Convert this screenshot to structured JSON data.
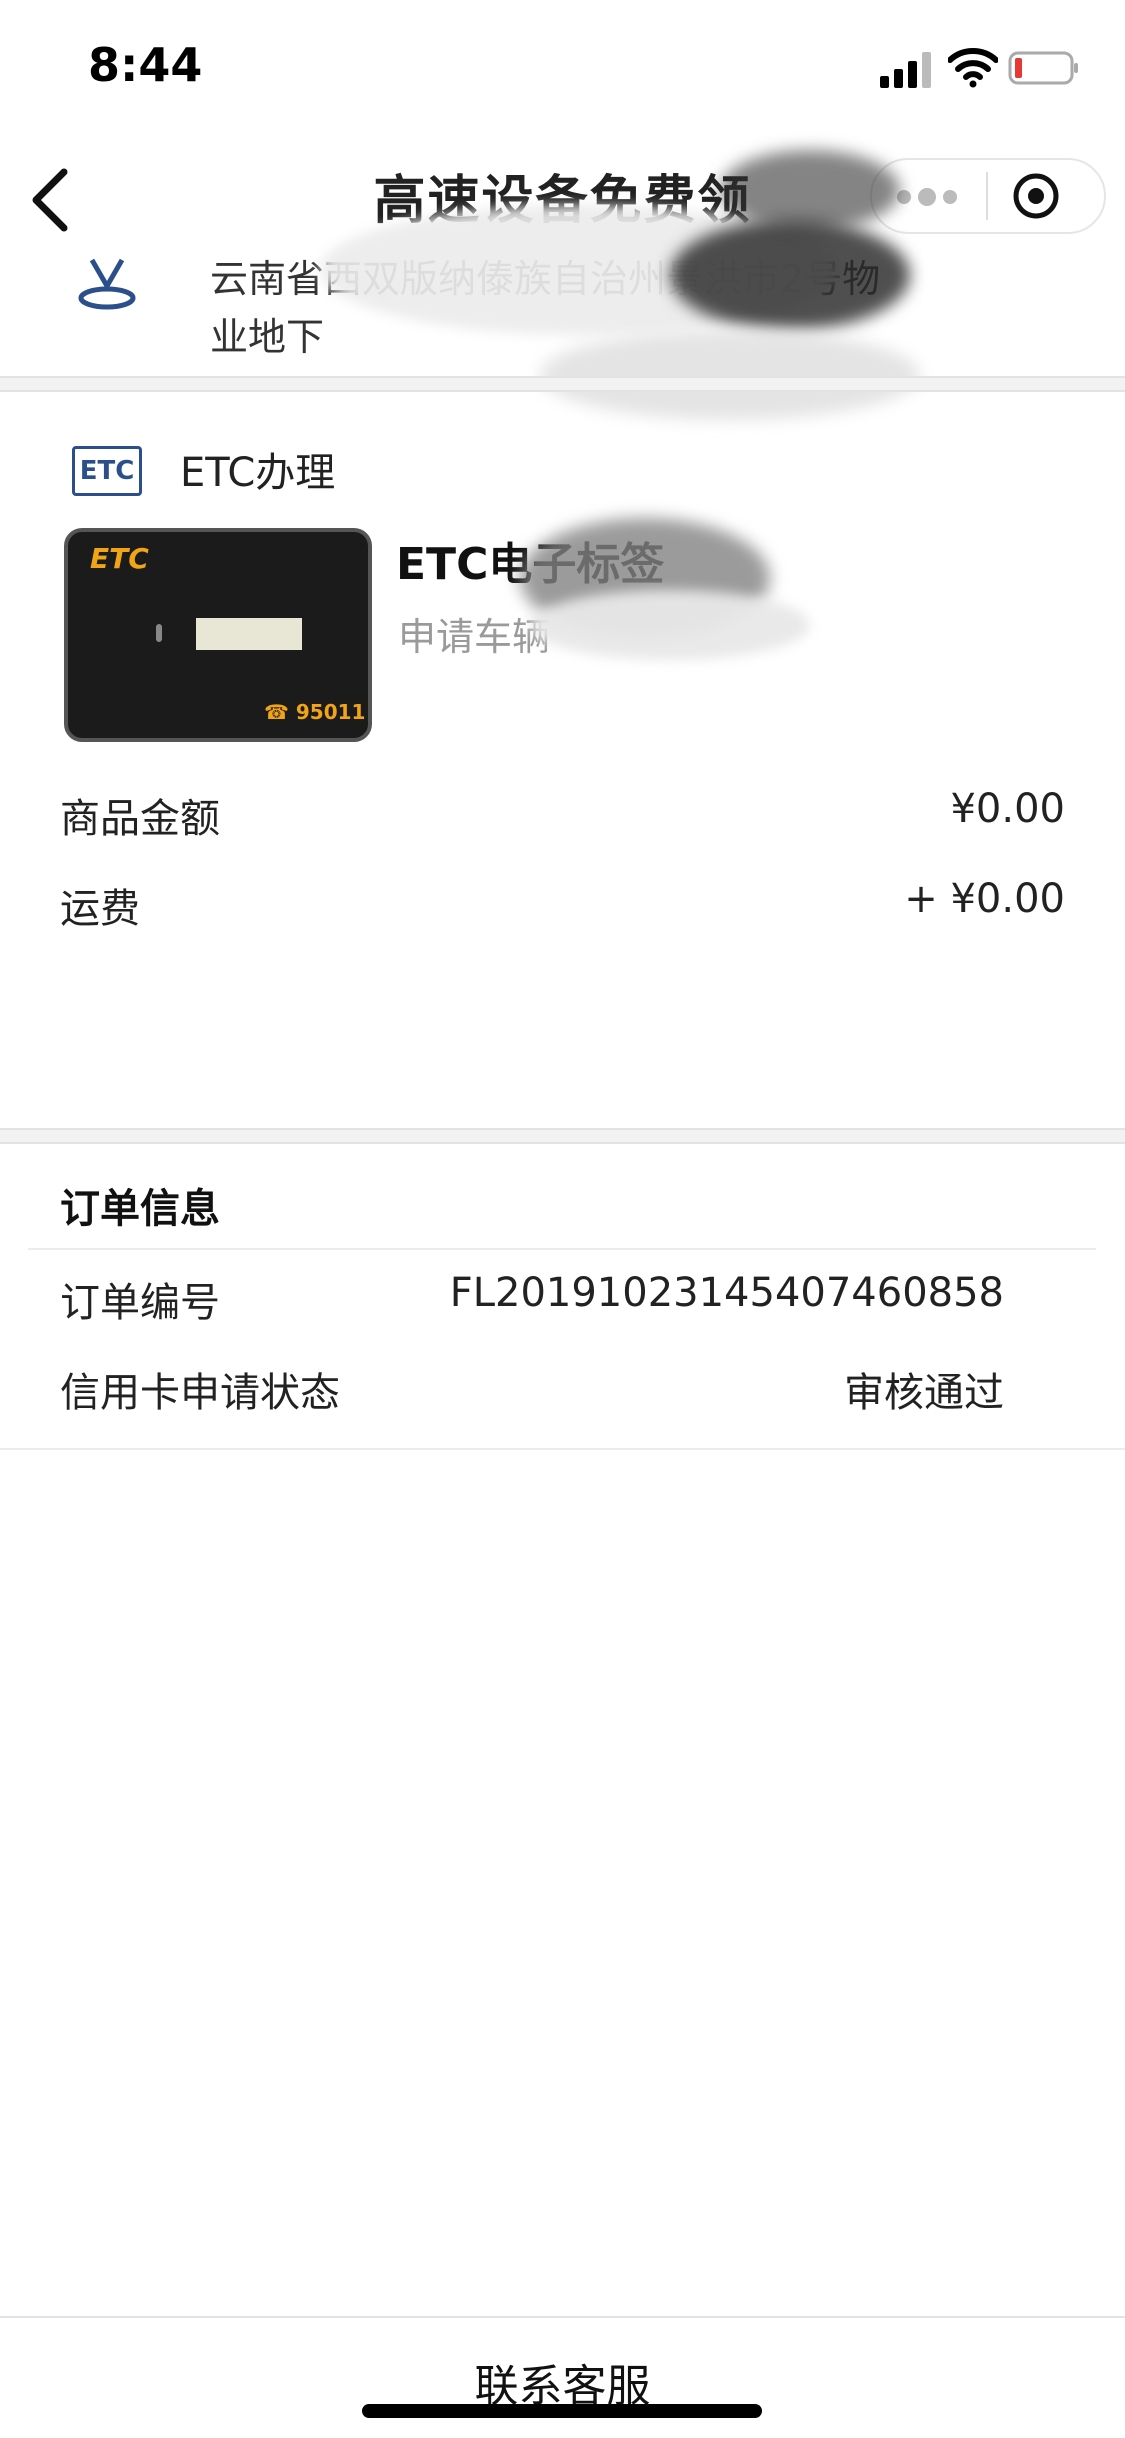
{
  "status_bar": {
    "time": "8:44"
  },
  "nav": {
    "title": "高速设备免费领"
  },
  "address": {
    "line1": "云南省西双版纳傣族自治州景洪市2号物",
    "line2": "业地下"
  },
  "etc_section": {
    "header_label": "ETC办理",
    "badge": "ETC",
    "product_image_logo": "ETC",
    "product_image_phone": "☎ 95011",
    "product_title": "ETC电子标签",
    "product_subtitle": "申请车辆"
  },
  "fees": {
    "goods_label": "商品金额",
    "goods_value": "¥0.00",
    "shipping_label": "运费",
    "shipping_value": "+ ¥0.00"
  },
  "order_info": {
    "title": "订单信息",
    "number_label": "订单编号",
    "number_value": "FL20191023145407460858",
    "status_label": "信用卡申请状态",
    "status_value": "审核通过"
  },
  "bottom": {
    "contact_label": "联系客服"
  },
  "colors": {
    "etc_blue": "#2b4f8a",
    "etc_orange": "#f2a417",
    "gap_gray": "#f2f2f2"
  }
}
